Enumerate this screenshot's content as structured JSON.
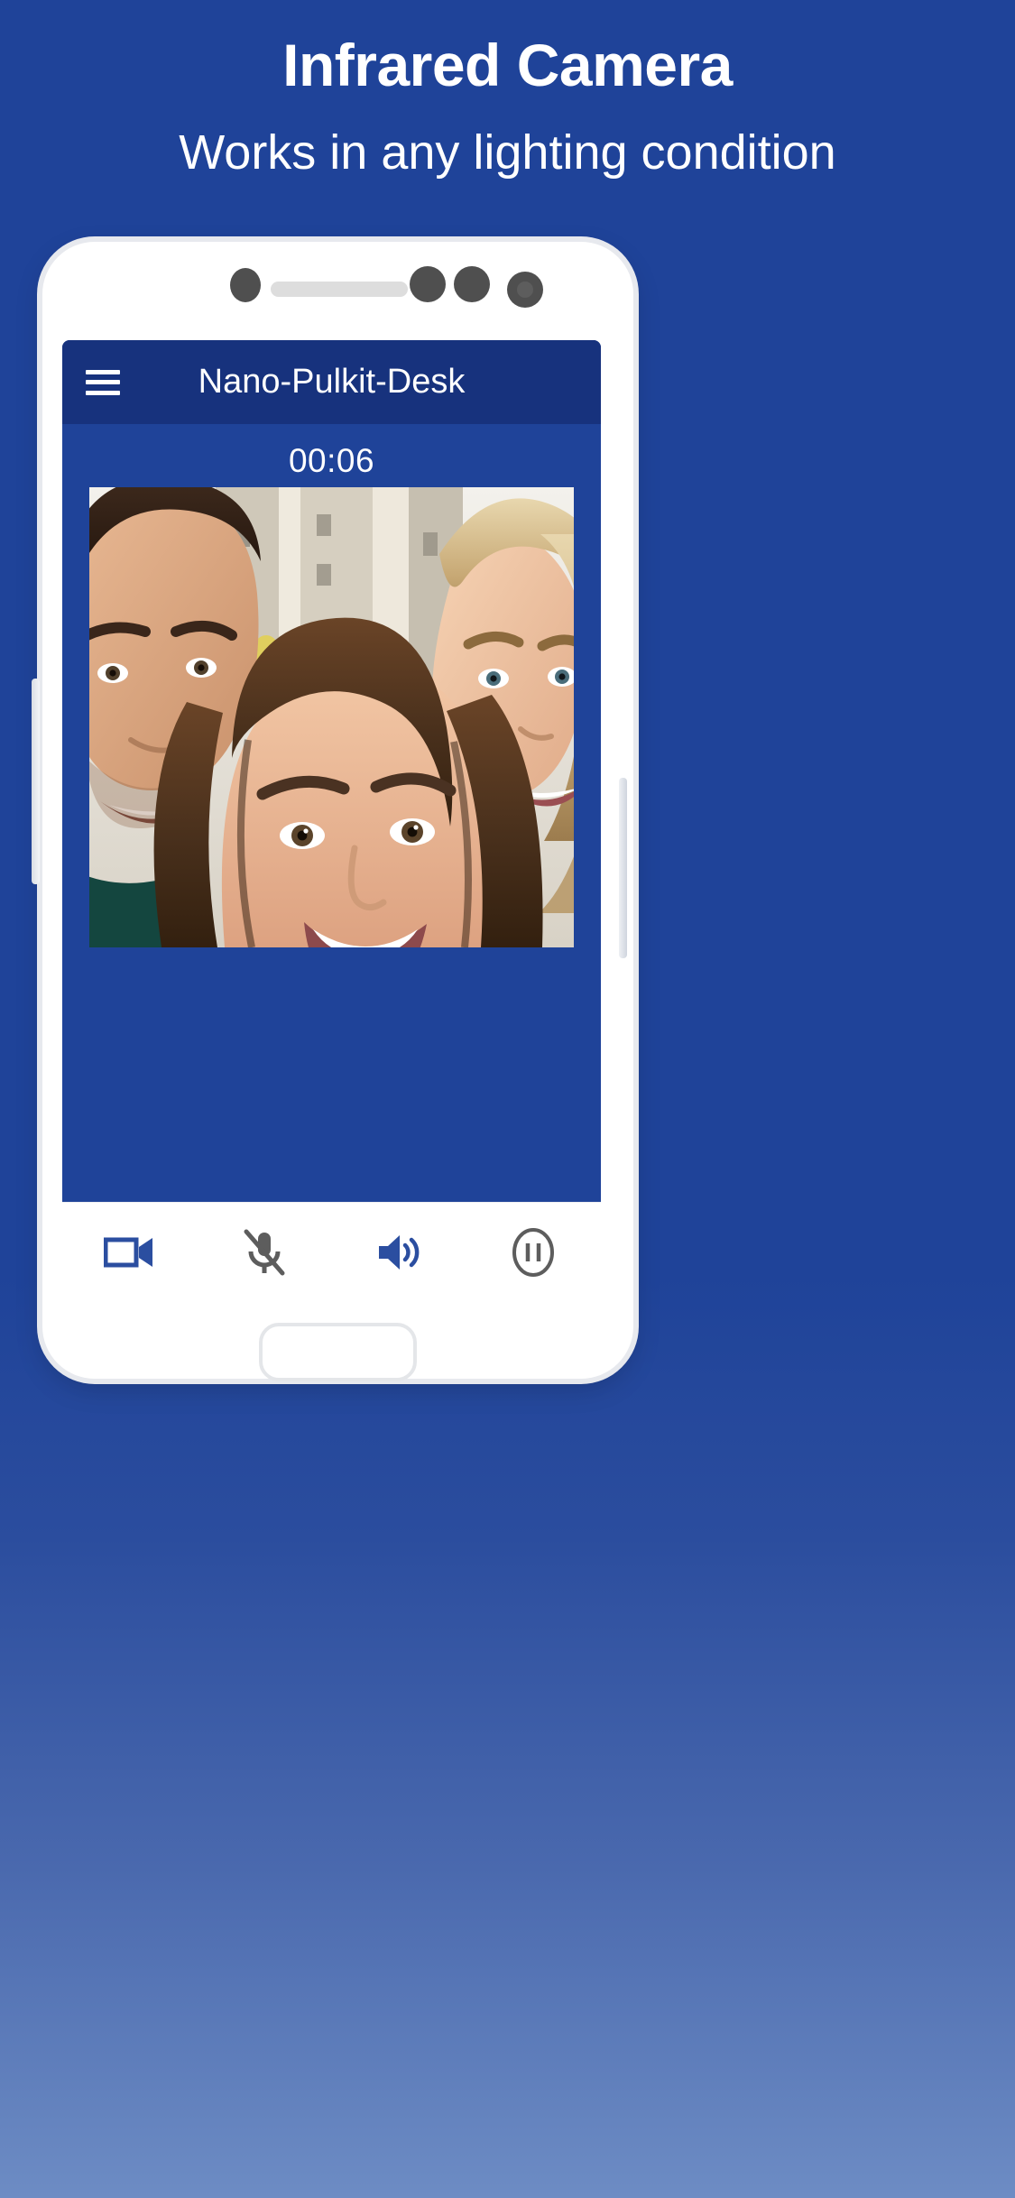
{
  "promo": {
    "title": "Infrared Camera",
    "subtitle": "Works in any lighting condition"
  },
  "colors": {
    "background_top": "#1f4399",
    "background_bottom": "#6d8cc4",
    "app_bar": "#17327d",
    "screen_bg": "#1f4399",
    "accent_icon": "#2b4ea0",
    "muted_icon": "#5d5d5d",
    "bezel": "#ffffff"
  },
  "phone": {
    "bezel_elements": [
      {
        "name": "proximity-sensor",
        "shape": "dot"
      },
      {
        "name": "earpiece-speaker",
        "shape": "bar"
      },
      {
        "name": "light-sensor",
        "shape": "dot"
      },
      {
        "name": "ir-sensor",
        "shape": "dot"
      },
      {
        "name": "front-camera",
        "shape": "lens"
      }
    ],
    "side_buttons": [
      "volume-rocker",
      "power-button"
    ],
    "home_indicator": "home-button"
  },
  "app": {
    "menu_icon": "hamburger-menu-icon",
    "title": "Nano-Pulkit-Desk",
    "call_timer": "00:06",
    "video_label": "live-video-feed"
  },
  "controls": [
    {
      "id": "video-toggle",
      "icon": "video-camera-icon",
      "label": "Video",
      "state": "on",
      "color": "#2b4ea0"
    },
    {
      "id": "mic-toggle",
      "icon": "mic-off-icon",
      "label": "Mute",
      "state": "muted",
      "color": "#5d5d5d"
    },
    {
      "id": "speaker-toggle",
      "icon": "speaker-icon",
      "label": "Speaker",
      "state": "on",
      "color": "#2b4ea0"
    },
    {
      "id": "pause-call",
      "icon": "pause-circle-icon",
      "label": "Pause",
      "state": "off",
      "color": "#5d5d5d"
    }
  ]
}
